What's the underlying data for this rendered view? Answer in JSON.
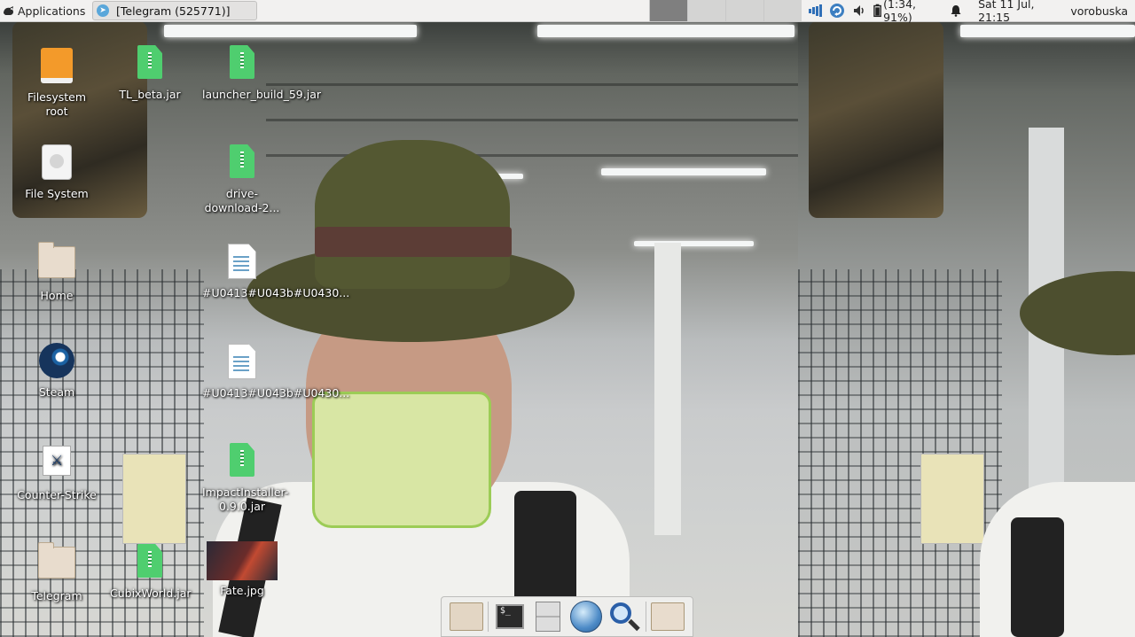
{
  "panel": {
    "applications_label": "Applications",
    "task_title": "[Telegram (525771)]",
    "battery_text": "(1:34, 91%)",
    "datetime": "Sat 11 Jul, 21:15",
    "username": "vorobuska",
    "icons": [
      "xfce-mouse-icon",
      "telegram-icon",
      "signal-icon",
      "update-icon",
      "volume-icon",
      "battery-icon",
      "bell-icon"
    ]
  },
  "desktop": {
    "icons": [
      {
        "label": "Filesystem root",
        "icon": "drive-icon"
      },
      {
        "label": "File System",
        "icon": "disk-icon"
      },
      {
        "label": "Home",
        "icon": "home-folder-icon"
      },
      {
        "label": "Steam",
        "icon": "steam-icon"
      },
      {
        "label": "Counter-Strike",
        "icon": "counter-strike-icon"
      },
      {
        "label": "Telegram",
        "icon": "folder-icon"
      },
      {
        "label": "TL_beta.jar",
        "icon": "jar-icon"
      },
      {
        "label": "CubixWorld.jar",
        "icon": "jar-icon"
      },
      {
        "label": "launcher_build_59.jar",
        "icon": "jar-icon"
      },
      {
        "label": "drive-download-2...",
        "icon": "jar-icon"
      },
      {
        "label": "#U0413#U043b#U0430...",
        "icon": "document-icon"
      },
      {
        "label": "#U0413#U043b#U0430...",
        "icon": "document-icon"
      },
      {
        "label": "ImpactInstaller-0.9.0.jar",
        "icon": "jar-icon"
      },
      {
        "label": "Fate.jpg",
        "icon": "image-thumbnail"
      }
    ]
  },
  "dock": {
    "items": [
      "home-folder-icon",
      "terminal-icon",
      "file-cabinet-icon",
      "web-browser-icon",
      "search-icon",
      "folder-icon"
    ],
    "terminal_prompt": "$_"
  },
  "colors": {
    "panel_bg": "#f2f1f0",
    "jar_green": "#4fce6f",
    "drive_orange": "#f39a2a"
  }
}
